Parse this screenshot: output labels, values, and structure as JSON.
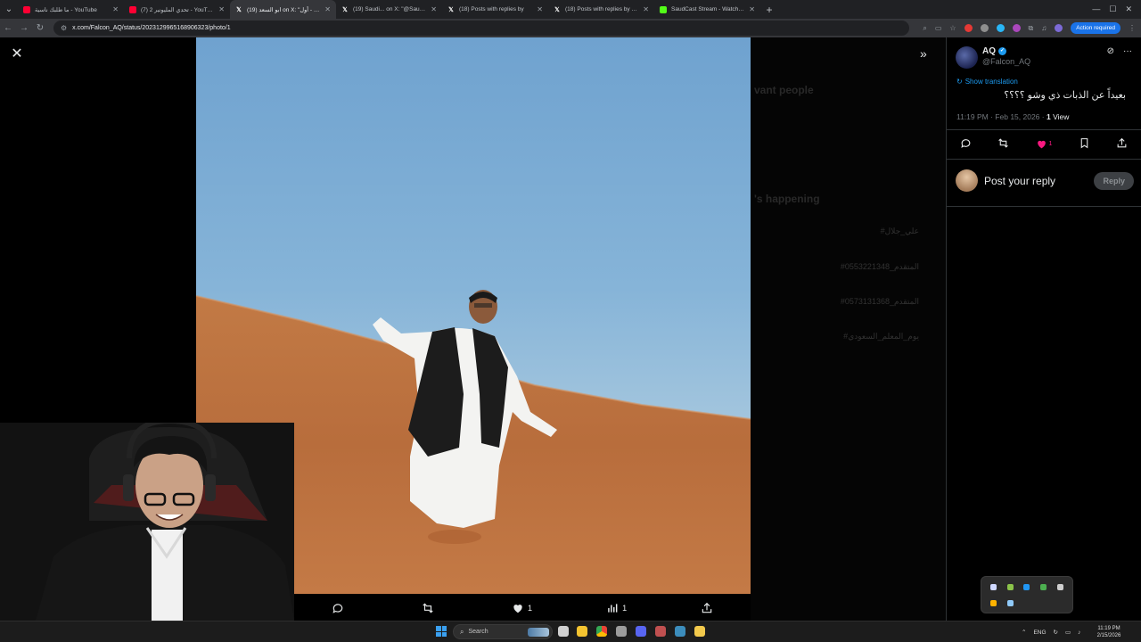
{
  "browser": {
    "tabs": [
      {
        "title": "ما طلبك ناسية - YouTube",
        "icon": "youtube-icon",
        "color": "#ff0033"
      },
      {
        "title": "(7) تحدي المليونير 2 - YouTube",
        "icon": "youtube-icon",
        "color": "#ff0033"
      },
      {
        "title": "(19) ابو السعد on X: \"ميمز - أول",
        "icon": "x-icon",
        "color": "#ffffff",
        "active": true
      },
      {
        "title": "(19) Saudi... on X: \"@Saudi...",
        "icon": "x-icon",
        "color": "#ffffff"
      },
      {
        "title": "(18) Posts with replies by",
        "icon": "x-icon",
        "color": "#ffffff"
      },
      {
        "title": "(18) Posts with replies by Hamad",
        "icon": "x-icon",
        "color": "#ffffff"
      },
      {
        "title": "SaudCast Stream - Watch Live",
        "icon": "kick-icon",
        "color": "#53fc18"
      }
    ],
    "url": "x.com/Falcon_AQ/status/2023129965168906323/photo/1",
    "action_required": "Action required"
  },
  "viewer": {
    "actions": {
      "reply_count": "",
      "retweet_count": "",
      "like_count": "1",
      "views_count": "1"
    }
  },
  "tweet": {
    "display_name": "AQ",
    "handle": "@Falcon_AQ",
    "show_translation": "Show translation",
    "text": "بعيداً عن الذبات ذي وشو ؟؟؟؟",
    "time": "11:19 PM · Feb 15, 2026 · ",
    "views": "1",
    "views_label": " View",
    "like_count": "1",
    "reply_placeholder": "Post your reply",
    "reply_button": "Reply"
  },
  "taskbar": {
    "search_label": "Search",
    "language": "ENG",
    "time": "11:19 PM",
    "date": "2/15/2026"
  }
}
